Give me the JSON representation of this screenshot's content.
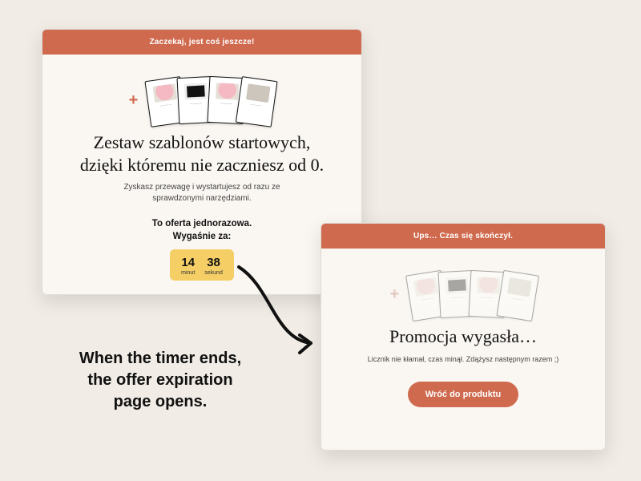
{
  "offer": {
    "header": "Zaczekaj, jest coś jeszcze!",
    "headline_line1": "Zestaw szablonów startowych,",
    "headline_line2": "dzięki któremu nie zaczniesz od 0.",
    "subtext": "Zyskasz przewagę i wystartujesz od razu ze sprawdzonymi narzędziami.",
    "timer_label_line1": "To oferta jednorazowa.",
    "timer_label_line2": "Wygaśnie za:",
    "timer": {
      "minutes": "14",
      "minutes_unit": "minut",
      "seconds": "38",
      "seconds_unit": "sekund"
    }
  },
  "expired": {
    "header": "Ups… Czas się skończył.",
    "headline": "Promocja wygasła…",
    "subtext": "Licznik nie kłamał, czas minął. Zdążysz następnym razem ;)",
    "back_button": "Wróć do produktu"
  },
  "caption": {
    "line1": "When the timer ends,",
    "line2": "the offer expiration",
    "line3": "page opens."
  },
  "icons": {
    "plus": "+"
  },
  "colors": {
    "accent": "#cf6a4f",
    "timer_bg": "#f5cf66",
    "page_bg": "#f1ece5",
    "panel_bg": "#faf7f2"
  }
}
